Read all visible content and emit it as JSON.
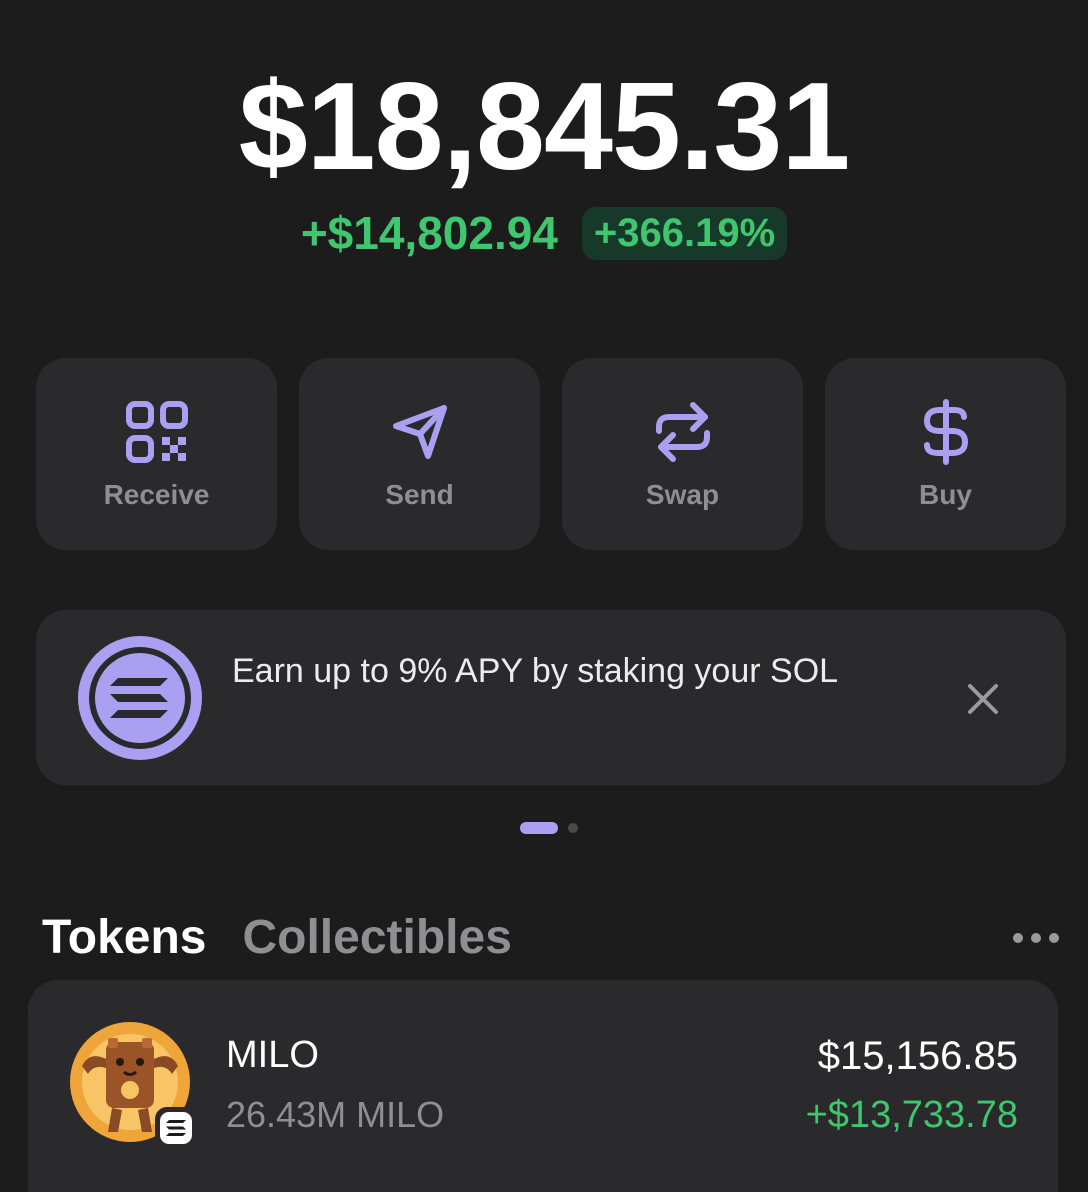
{
  "balance": {
    "total": "$18,845.31",
    "change_amount": "+$14,802.94",
    "change_percent": "+366.19%"
  },
  "actions": [
    {
      "label": "Receive",
      "icon": "qr-code-icon"
    },
    {
      "label": "Send",
      "icon": "send-icon"
    },
    {
      "label": "Swap",
      "icon": "swap-icon"
    },
    {
      "label": "Buy",
      "icon": "dollar-icon"
    }
  ],
  "banner": {
    "text": "Earn up to 9% APY by staking your SOL",
    "icon": "solana-logo-icon",
    "close_icon": "close-icon"
  },
  "pager": {
    "count": 2,
    "active": 0
  },
  "tabs": [
    {
      "label": "Tokens",
      "active": true
    },
    {
      "label": "Collectibles",
      "active": false
    }
  ],
  "tokens": [
    {
      "name": "MILO",
      "amount": "26.43M MILO",
      "value": "$15,156.85",
      "change": "+$13,733.78",
      "icon": "milo-token-icon",
      "chain_badge": "solana-badge-icon"
    }
  ],
  "colors": {
    "background": "#1c1c1d",
    "card": "#2a2a2c",
    "accent": "#ab9ff2",
    "positive": "#3fc66e",
    "muted": "#8e8e93"
  }
}
